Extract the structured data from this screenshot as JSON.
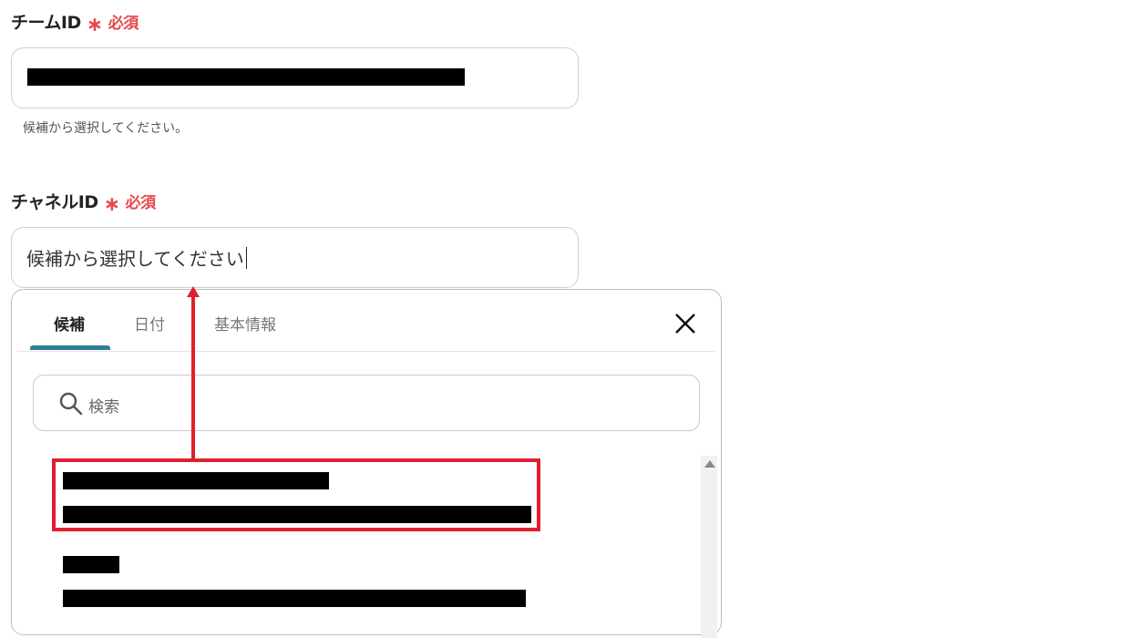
{
  "team_field": {
    "label": "チームID",
    "required_mark": "∗",
    "required_text": "必須",
    "helper": "候補から選択してください。"
  },
  "channel_field": {
    "label": "チャネルID",
    "required_mark": "∗",
    "required_text": "必須",
    "value": "候補から選択してください"
  },
  "dropdown": {
    "tabs": [
      {
        "label": "候補"
      },
      {
        "label": "日付"
      },
      {
        "label": "基本情報"
      }
    ],
    "search_placeholder": "検索"
  },
  "colors": {
    "required": "#e5484d",
    "tab_active_underline": "#2f7d96",
    "annotation": "#e01f2e"
  }
}
